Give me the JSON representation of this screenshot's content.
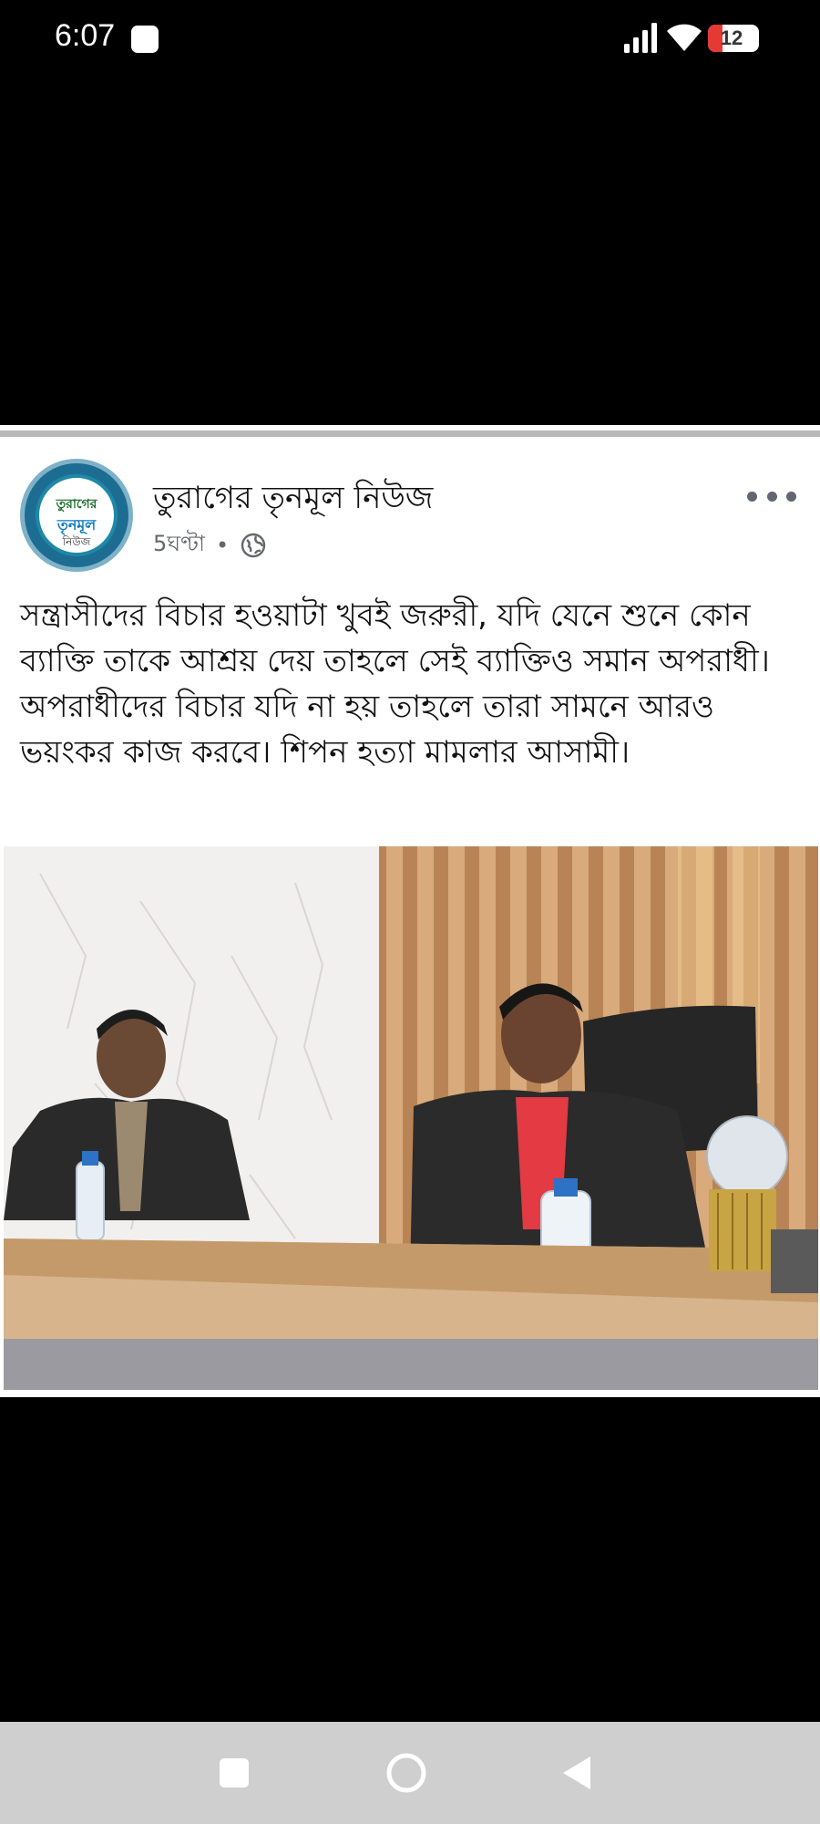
{
  "status_bar": {
    "time": "6:07",
    "battery": "12"
  },
  "post": {
    "page_name": "তুরাগের তৃনমূল নিউজ",
    "time_ago": "5ঘণ্টা",
    "separator": "•",
    "avatar_logo": {
      "top": "তুরাগের",
      "mid": "তৃনমূল",
      "bottom": "নিউজ"
    },
    "text": "সন্ত্রাসীদের বিচার হওয়াটা খুবই জরুরী, যদি যেনে শুনে কোন ব্যাক্তি তাকে আশ্রয় দেয় তাহলে সেই ব্যাক্তিও সমান অপরাধী। অপরাধীদের বিচার যদি না হয় তাহলে তারা সামনে আরও ভয়ংকর কাজ করবে। শিপন হত্যা মামলার আসামী।"
  },
  "icons": {
    "more": "more-horizontal-icon",
    "privacy": "globe-icon",
    "nav_recent": "square-icon",
    "nav_home": "circle-icon",
    "nav_back": "triangle-back-icon"
  },
  "colors": {
    "accent_battery": "#e53935",
    "meta_gray": "#65676b",
    "navbar": "#cfcfcf"
  }
}
